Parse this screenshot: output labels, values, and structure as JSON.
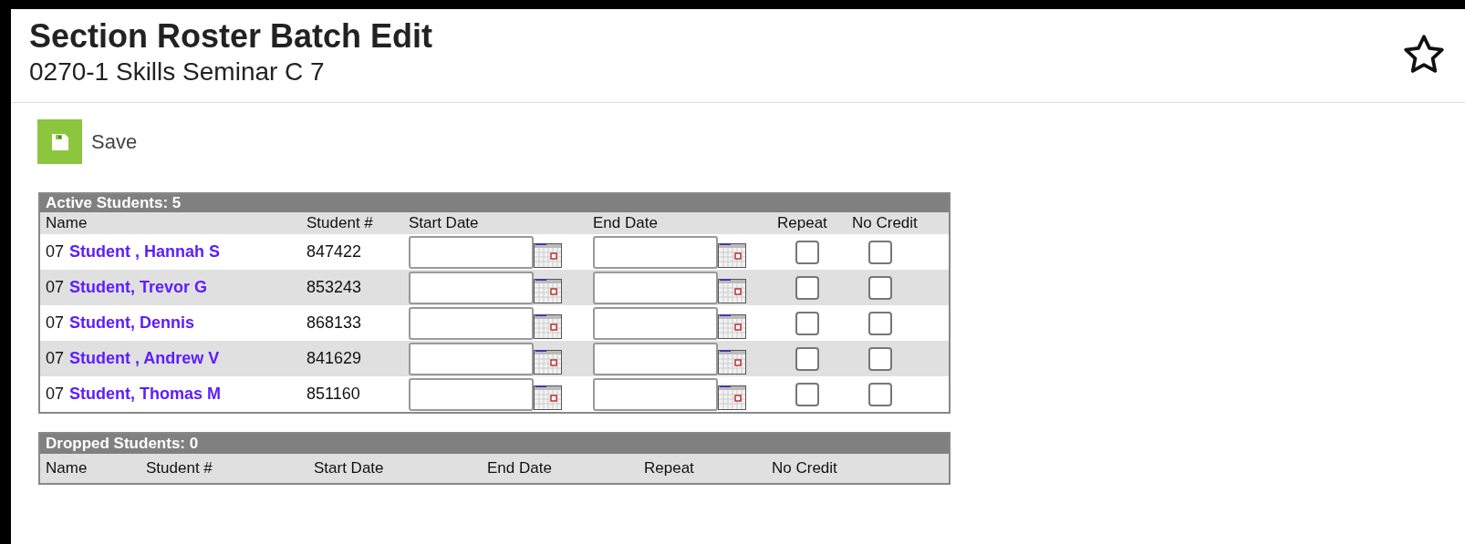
{
  "header": {
    "title": "Section Roster Batch Edit",
    "subtitle": "0270-1 Skills Seminar C 7",
    "favorite": false
  },
  "toolbar": {
    "save_label": "Save"
  },
  "active_table": {
    "title": "Active Students: 5",
    "columns": [
      "Name",
      "Student #",
      "Start Date",
      "End Date",
      "Repeat",
      "No Credit"
    ],
    "rows": [
      {
        "grade": "07",
        "name": "Student , Hannah S",
        "student_number": "847422",
        "repeat": false,
        "no_credit": false
      },
      {
        "grade": "07",
        "name": "Student, Trevor G",
        "student_number": "853243",
        "repeat": false,
        "no_credit": false
      },
      {
        "grade": "07",
        "name": "Student, Dennis",
        "student_number": "868133",
        "repeat": false,
        "no_credit": false
      },
      {
        "grade": "07",
        "name": "Student , Andrew V",
        "student_number": "841629",
        "repeat": false,
        "no_credit": false
      },
      {
        "grade": "07",
        "name": "Student, Thomas M",
        "student_number": "851160",
        "repeat": false,
        "no_credit": false
      }
    ]
  },
  "dropped_table": {
    "title": "Dropped Students: 0",
    "columns": [
      "Name",
      "Student #",
      "Start Date",
      "End Date",
      "Repeat",
      "No Credit"
    ]
  }
}
